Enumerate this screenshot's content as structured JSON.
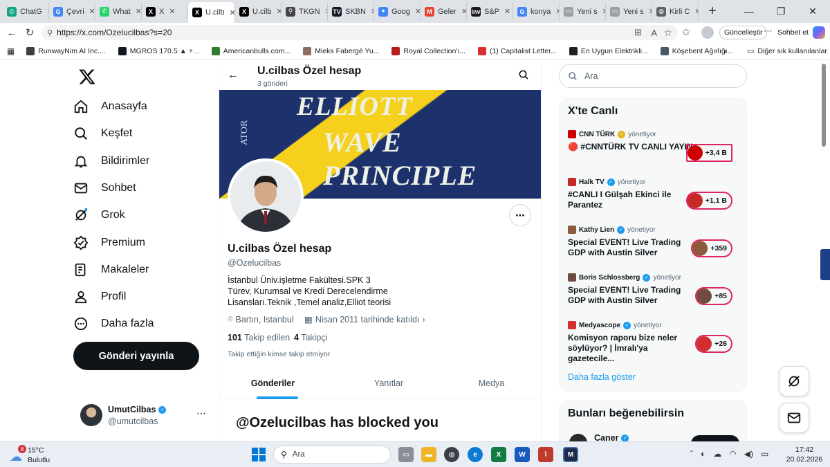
{
  "browser": {
    "tabs": [
      {
        "label": "ChatG",
        "color": "#10a37f",
        "glyph": "◎",
        "active": false
      },
      {
        "label": "Çevri",
        "color": "#4285f4",
        "glyph": "G",
        "active": false
      },
      {
        "label": "What",
        "color": "#25d366",
        "glyph": "✆",
        "active": false
      },
      {
        "label": "X",
        "color": "#000000",
        "glyph": "X",
        "active": false
      },
      {
        "label": "U.cilb",
        "color": "#000000",
        "glyph": "X",
        "active": true
      },
      {
        "label": "U.cilb",
        "color": "#000000",
        "glyph": "X",
        "active": false
      },
      {
        "label": "TKGN",
        "color": "#444444",
        "glyph": "⚲",
        "active": false
      },
      {
        "label": "SKBN",
        "color": "#131722",
        "glyph": "TV",
        "active": false
      },
      {
        "label": "Goog",
        "color": "#4285f4",
        "glyph": "✦",
        "active": false
      },
      {
        "label": "Geler",
        "color": "#ea4335",
        "glyph": "M",
        "active": false
      },
      {
        "label": "S&P",
        "color": "#1a1a1a",
        "glyph": "inv",
        "active": false
      },
      {
        "label": "konya",
        "color": "#4285f4",
        "glyph": "G",
        "active": false
      },
      {
        "label": "Yeni s",
        "color": "#9aa0a6",
        "glyph": "▭",
        "active": false
      },
      {
        "label": "Yeni s",
        "color": "#9aa0a6",
        "glyph": "▭",
        "active": false
      },
      {
        "label": "Kirli C",
        "color": "#5f6368",
        "glyph": "◍",
        "active": false
      }
    ],
    "url": "https://x.com/Ozelucilbas?s=20",
    "update_label": "Güncelleştir",
    "chat_label": "Sohbet et",
    "bookmarks": [
      {
        "label": "RunwayNim AI Inc....",
        "color": "#3c4043"
      },
      {
        "label": "MGROS 170.5 ▲ +...",
        "color": "#131722"
      },
      {
        "label": "Americanbulls.com...",
        "color": "#2e7d32"
      },
      {
        "label": "Mieks Fabergé Yu...",
        "color": "#8d6e63"
      },
      {
        "label": "Royal Collection'ı...",
        "color": "#b71c1c"
      },
      {
        "label": "(1) Capitalist Letter...",
        "color": "#d32f2f"
      },
      {
        "label": "En Uygun Elektrikli...",
        "color": "#212121"
      },
      {
        "label": "Köşebent Ağırlığı...",
        "color": "#455a64"
      }
    ],
    "other_bookmarks": "Diğer sık kullanılanlar"
  },
  "nav": {
    "items": [
      {
        "label": "Anasayfa",
        "icon": "home-icon"
      },
      {
        "label": "Keşfet",
        "icon": "search-icon"
      },
      {
        "label": "Bildirimler",
        "icon": "bell-icon"
      },
      {
        "label": "Sohbet",
        "icon": "mail-icon"
      },
      {
        "label": "Grok",
        "icon": "grok-icon"
      },
      {
        "label": "Premium",
        "icon": "verified-badge-icon"
      },
      {
        "label": "Makaleler",
        "icon": "article-icon"
      },
      {
        "label": "Profil",
        "icon": "person-icon"
      },
      {
        "label": "Daha fazla",
        "icon": "more-circle-icon"
      }
    ],
    "post_button": "Gönderi yayınla",
    "account": {
      "name": "UmutCilbas",
      "handle": "@umutcilbas"
    }
  },
  "profile": {
    "header_name": "U.cilbas Özel hesap",
    "post_count": "3 gönderi",
    "banner_lines": [
      "ELLIOTT",
      "WAVE",
      "PRINCIPLE"
    ],
    "name": "U.cilbas Özel hesap",
    "handle": "@Ozelucilbas",
    "bio": "İstanbul Üniv.işletme Fakültesi.SPK 3 Türev, Kurumsal ve Kredi Derecelendirme Lisansları.Teknik ,Temel analiz,Elliot teorisi",
    "location": "Bartın, Istanbul",
    "joined": "Nisan 2011 tarihinde katıldı",
    "following_count": "101",
    "following_label": "Takip edilen",
    "followers_count": "4",
    "followers_label": "Takipçi",
    "followed_by_note": "Takip ettiğin kimse takip etmiyor",
    "tabs": [
      "Gönderiler",
      "Yanıtlar",
      "Medya"
    ],
    "blocked_text": "@Ozelucilbas has blocked you"
  },
  "sidebar": {
    "search_placeholder": "Ara",
    "live_title": "X'te Canlı",
    "live": [
      {
        "host": "CNN TÜRK",
        "role": "yönetiyor",
        "title": "🔴 #CNNTÜRK TV CANLI YAYIN",
        "count": "+3,4 B",
        "color": "#cc0000",
        "gold": true
      },
      {
        "host": "Halk TV",
        "role": "yönetiyor",
        "title": "#CANLI I Gülşah Ekinci ile Parantez",
        "count": "+1,1 B",
        "color": "#c62828",
        "gold": false
      },
      {
        "host": "Kathy Lien",
        "role": "yönetiyor",
        "title": "Special EVENT! Live Trading GDP with Austin Silver",
        "count": "+359",
        "color": "#8d5a3b",
        "gold": false
      },
      {
        "host": "Boris Schlossberg",
        "role": "yönetiyor",
        "title": "Special EVENT! Live Trading GDP with Austin Silver",
        "count": "+85",
        "color": "#6d4c41",
        "gold": false
      },
      {
        "host": "Medyascope",
        "role": "yönetiyor",
        "title": "Komisyon raporu bize neler söylüyor? | İmralı'ya gazetecile...",
        "count": "+26",
        "color": "#d32f2f",
        "gold": false
      }
    ],
    "show_more": "Daha fazla göster",
    "suggest_title": "Bunları beğenebilirsin",
    "suggest_first": "Caner"
  },
  "taskbar": {
    "weather_temp": "15°C",
    "weather_desc": "Bulutlu",
    "weather_badge": "8",
    "search_placeholder": "Ara",
    "time": "17:42",
    "date": "20.02.2026"
  }
}
